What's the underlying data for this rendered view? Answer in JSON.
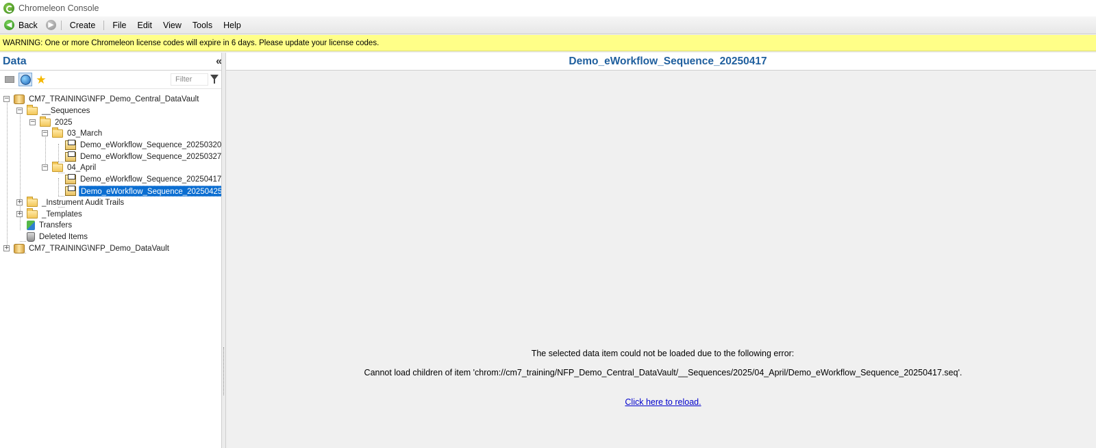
{
  "window": {
    "title": "Chromeleon Console"
  },
  "menubar": {
    "back_label": "Back",
    "create_label": "Create",
    "items": [
      "File",
      "Edit",
      "View",
      "Tools",
      "Help"
    ]
  },
  "warning": {
    "text": "WARNING: One or more Chromeleon license codes will expire in 6 days. Please update your license codes."
  },
  "left_panel": {
    "title": "Data",
    "collapse_glyph": "«",
    "filter_placeholder": "Filter",
    "tree": [
      {
        "label": "CM7_TRAINING\\NFP_Demo_Central_DataVault",
        "icon": "datavault-icon",
        "expander": "−"
      },
      {
        "label": "__Sequences",
        "icon": "folder-icon",
        "expander": "−"
      },
      {
        "label": "2025",
        "icon": "folder-icon",
        "expander": "−"
      },
      {
        "label": "03_March",
        "icon": "folder-icon",
        "expander": "−"
      },
      {
        "label": "Demo_eWorkflow_Sequence_20250320",
        "icon": "sequence-icon"
      },
      {
        "label": "Demo_eWorkflow_Sequence_20250327",
        "icon": "sequence-icon"
      },
      {
        "label": "04_April",
        "icon": "folder-icon",
        "expander": "−"
      },
      {
        "label": "Demo_eWorkflow_Sequence_20250417",
        "icon": "sequence-icon"
      },
      {
        "label": "Demo_eWorkflow_Sequence_20250425",
        "icon": "sequence-icon",
        "selected": true
      },
      {
        "label": "_Instrument Audit Trails",
        "icon": "folder-icon",
        "expander": "+"
      },
      {
        "label": "_Templates",
        "icon": "folder-icon",
        "expander": "+"
      },
      {
        "label": "Transfers",
        "icon": "transfers-icon"
      },
      {
        "label": "Deleted Items",
        "icon": "trash-icon"
      },
      {
        "label": "CM7_TRAINING\\NFP_Demo_DataVault",
        "icon": "datavault-icon",
        "expander": "+"
      }
    ]
  },
  "right_panel": {
    "title": "Demo_eWorkflow_Sequence_20250417",
    "error_heading": "The selected data item could not be loaded due to the following error:",
    "error_detail": "Cannot load children of item 'chrom://cm7_training/NFP_Demo_Central_DataVault/__Sequences/2025/04_April/Demo_eWorkflow_Sequence_20250417.seq'.",
    "reload_link": "Click here to reload."
  },
  "colors": {
    "accent_title": "#1f5f9e",
    "warning_bg": "#ffff88",
    "selection": "#0b6ed1",
    "link": "#0000cc"
  }
}
